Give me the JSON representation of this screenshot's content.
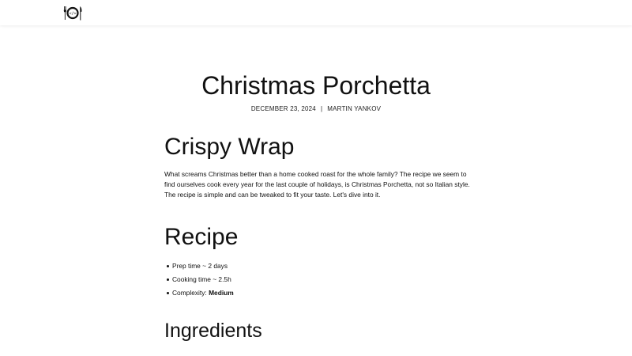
{
  "header": {
    "logo_icon": "plate-with-fork-and-knife-icon",
    "logo_text": "</>"
  },
  "post": {
    "title": "Christmas Porchetta",
    "date": "DECEMBER 23, 2024",
    "separator": "|",
    "author": "MARTIN YANKOV"
  },
  "sections": {
    "crispy_wrap": {
      "heading": "Crispy Wrap",
      "paragraph": "What screams Christmas better than a home cooked roast for the whole family? The recipe we seem to find ourselves cook every year for the last couple of holidays, is Christmas Porchetta, not so Italian style. The recipe is simple and can be tweaked to fit your taste. Let's dive into it."
    },
    "recipe": {
      "heading": "Recipe",
      "items": [
        {
          "text": "Prep time ~ 2 days"
        },
        {
          "text": "Cooking time ~ 2.5h"
        },
        {
          "label": "Complexity: ",
          "value": "Medium"
        }
      ]
    },
    "ingredients": {
      "heading": "Ingredients"
    }
  },
  "colors": {
    "background": "#ffffff",
    "text": "#111111"
  }
}
